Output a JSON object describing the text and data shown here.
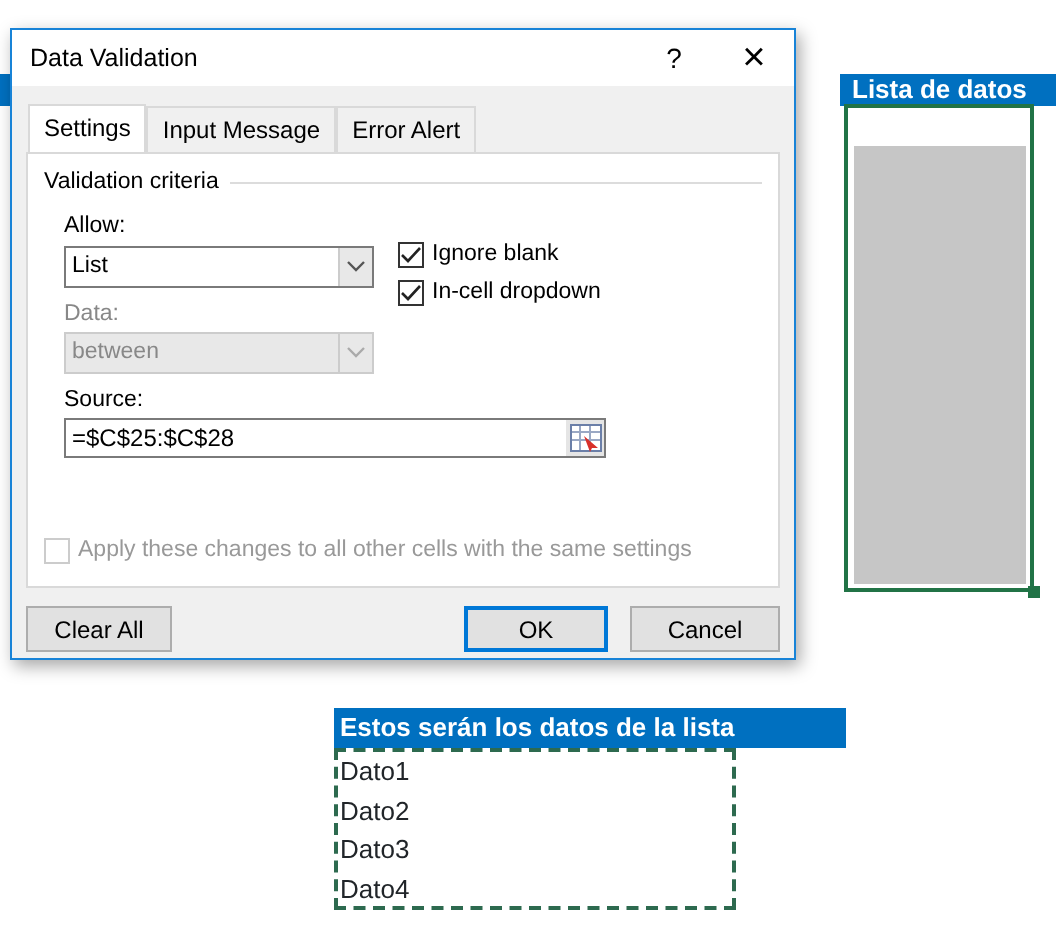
{
  "sheet": {
    "list_header": "Lista de datos",
    "list_cell": {
      "selected": true
    },
    "source_header": "Estos serán los datos de la lista",
    "source_cells": [
      "Dato1",
      "Dato2",
      "Dato3",
      "Dato4"
    ]
  },
  "dialog": {
    "title": "Data Validation",
    "help": "?",
    "close": "×",
    "tabs": [
      {
        "label": "Settings",
        "selected": true
      },
      {
        "label": "Input Message",
        "selected": false
      },
      {
        "label": "Error Alert",
        "selected": false
      }
    ],
    "group_title": "Validation criteria",
    "allow": {
      "label": "Allow:",
      "value": "List",
      "disabled": false
    },
    "data": {
      "label": "Data:",
      "value": "between",
      "disabled": true
    },
    "checkboxes": [
      {
        "label": "Ignore blank",
        "checked": true,
        "disabled": false
      },
      {
        "label": "In-cell dropdown",
        "checked": true,
        "disabled": false
      }
    ],
    "source": {
      "label": "Source:",
      "value": "=$C$25:$C$28"
    },
    "apply": {
      "label": "Apply these changes to all other cells with the same settings",
      "checked": false,
      "disabled": true
    },
    "buttons": [
      {
        "label": "Clear All",
        "kind": "left",
        "default": false
      },
      {
        "label": "OK",
        "kind": "right",
        "default": true
      },
      {
        "label": "Cancel",
        "kind": "right",
        "default": false
      }
    ]
  }
}
